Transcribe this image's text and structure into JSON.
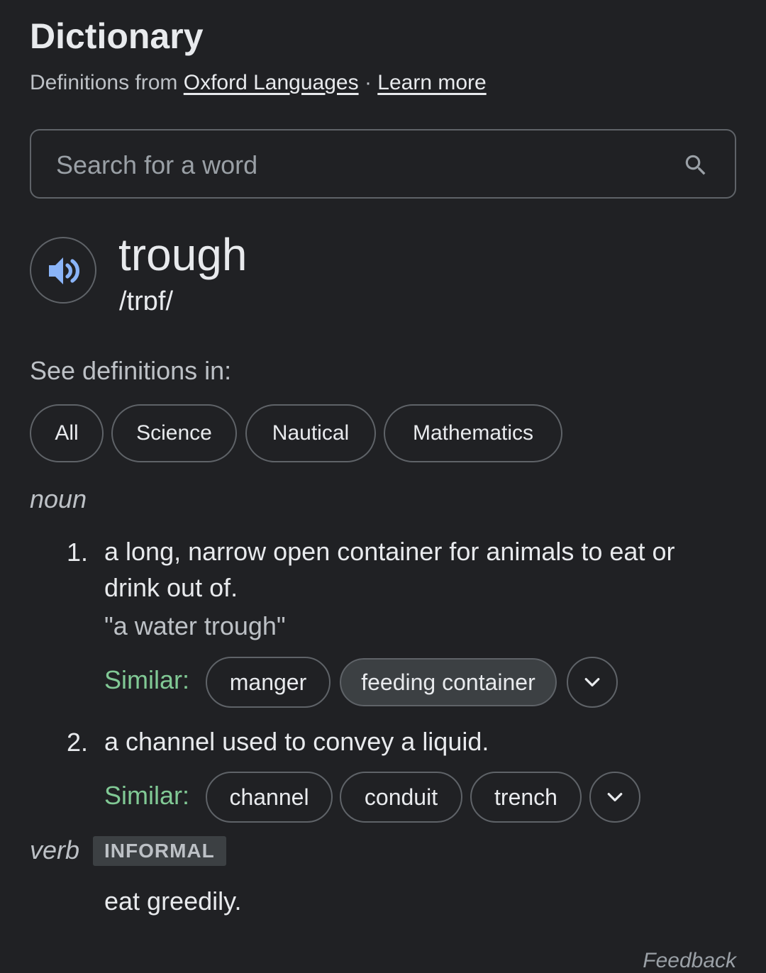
{
  "header": {
    "title": "Dictionary",
    "source_prefix": "Definitions from",
    "source_link": "Oxford Languages",
    "separator": "·",
    "learn_more": "Learn more"
  },
  "search": {
    "placeholder": "Search for a word",
    "icon": "search-icon"
  },
  "entry": {
    "word": "trough",
    "phonetic": "/trɒf/",
    "audio_icon": "speaker-icon",
    "audio_color": "#8ab4f8"
  },
  "see_definitions": {
    "label": "See definitions in:",
    "chips": [
      "All",
      "Science",
      "Nautical",
      "Mathematics"
    ]
  },
  "noun": {
    "label": "noun",
    "senses": [
      {
        "number": "1.",
        "definition_line1": "a long, narrow open container for animals to eat or",
        "definition_line2": "drink out of.",
        "example": "\"a water trough\"",
        "similar_label": "Similar:",
        "similar": [
          "manger",
          "feeding container"
        ]
      },
      {
        "number": "2.",
        "definition": "a channel used to convey a liquid.",
        "similar_label": "Similar:",
        "similar": [
          "channel",
          "conduit",
          "trench"
        ]
      }
    ]
  },
  "verb": {
    "label": "verb",
    "badge": "INFORMAL",
    "definition": "eat greedily."
  },
  "footer": {
    "feedback": "Feedback"
  },
  "colors": {
    "background": "#202124",
    "similar_green": "#81c995",
    "border": "#5f6368"
  }
}
